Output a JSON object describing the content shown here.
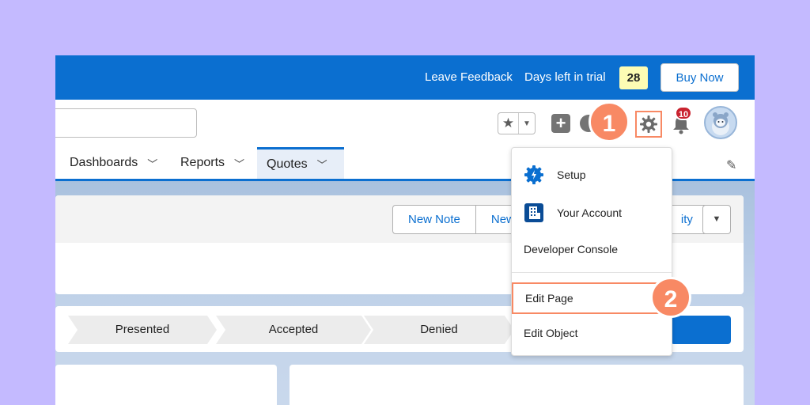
{
  "trial_bar": {
    "leave_feedback": "Leave Feedback",
    "days_left_label": "Days left in trial",
    "days_left_value": "28",
    "buy_now": "Buy Now"
  },
  "header": {
    "notification_count": "10",
    "step_markers": [
      "1",
      "2"
    ]
  },
  "nav": {
    "tabs": [
      {
        "label": "Dashboards"
      },
      {
        "label": "Reports"
      },
      {
        "label": "Quotes",
        "active": true
      }
    ]
  },
  "highlights": {
    "actions": [
      "New Note",
      "New",
      "ity"
    ]
  },
  "path": {
    "stages": [
      "Presented",
      "Accepted",
      "Denied"
    ]
  },
  "setup_menu": {
    "items": [
      {
        "label": "Setup",
        "icon": "setup-gear-icon"
      },
      {
        "label": "Your Account",
        "icon": "building-icon"
      },
      {
        "label": "Developer Console"
      },
      {
        "label": "Edit Page",
        "highlighted": true
      },
      {
        "label": "Edit Object"
      }
    ]
  },
  "colors": {
    "brand_blue": "#0b6fd0",
    "accent_orange": "#f88964",
    "background": "#c4baff"
  }
}
